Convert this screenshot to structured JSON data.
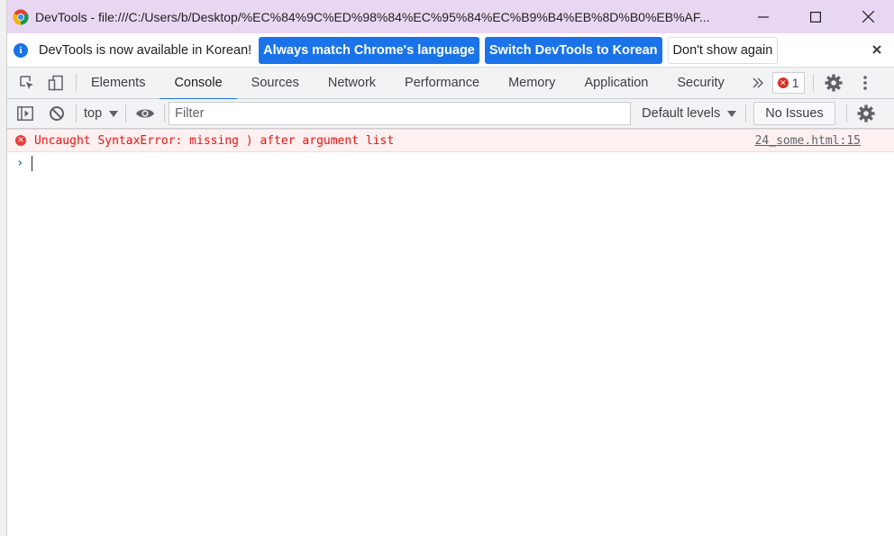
{
  "window": {
    "title": "DevTools - file:///C:/Users/b/Desktop/%EC%84%9C%ED%98%84%EC%95%84%EC%B9%B4%EB%8D%B0%EB%AF..."
  },
  "infobar": {
    "message": "DevTools is now available in Korean!",
    "always_match_label": "Always match Chrome's language",
    "switch_label": "Switch DevTools to Korean",
    "dont_show_label": "Don't show again"
  },
  "tabs": [
    {
      "label": "Elements"
    },
    {
      "label": "Console"
    },
    {
      "label": "Sources"
    },
    {
      "label": "Network"
    },
    {
      "label": "Performance"
    },
    {
      "label": "Memory"
    },
    {
      "label": "Application"
    },
    {
      "label": "Security"
    }
  ],
  "active_tab": "Console",
  "error_count": "1",
  "console_toolbar": {
    "context": "top",
    "filter_placeholder": "Filter",
    "levels_label": "Default levels",
    "issues_label": "No Issues"
  },
  "messages": [
    {
      "level": "error",
      "text": "Uncaught SyntaxError: missing ) after argument list",
      "source": "24_some.html:15"
    }
  ],
  "colors": {
    "title_bar": "#e8d7f3",
    "accent": "#1a73e8",
    "error_text": "#e81313",
    "error_bg": "#fdf0f0"
  }
}
